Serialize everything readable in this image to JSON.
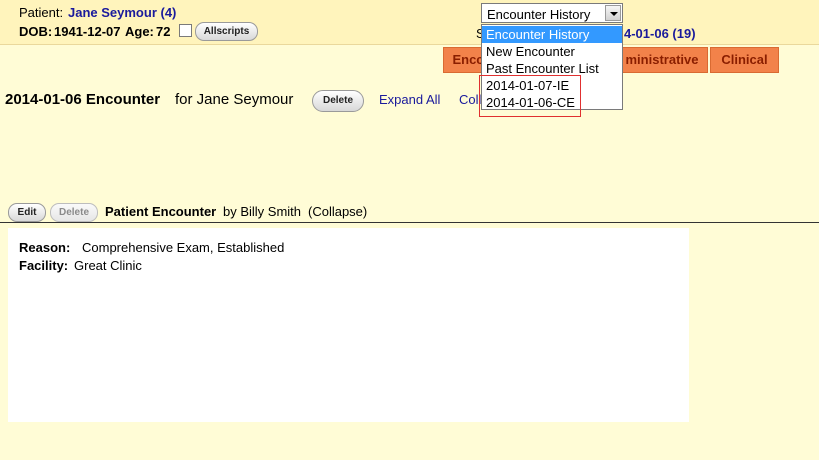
{
  "header": {
    "patient_label": "Patient:",
    "patient_name": "Jane Seymour (4)",
    "dob_label": "DOB:",
    "dob_value": "1941-12-07",
    "age_label": "Age:",
    "age_value": "72",
    "allscripts_label": "Allscripts",
    "encounter_select": {
      "selected": "Encounter History",
      "options": [
        "Encounter History",
        "New Encounter",
        "Past Encounter List",
        "2014-01-07-IE",
        "2014-01-06-CE"
      ]
    },
    "selected_encounter_prefix": "S",
    "selected_encounter_value": "4-01-06 (19)"
  },
  "tabs": {
    "encounter_partial": "Encc",
    "administrative_partial": "ministrative",
    "clinical": "Clinical"
  },
  "encounter": {
    "title": "2014-01-06 Encounter",
    "for_text": "for Jane Seymour",
    "delete_label": "Delete",
    "expand_all": "Expand All",
    "collapse_partial": "Coll"
  },
  "form_header": {
    "edit_label": "Edit",
    "delete_label": "Delete",
    "form_name": "Patient Encounter",
    "by_text": "by Billy Smith",
    "collapse_text": "(Collapse)"
  },
  "details": {
    "reason_label": "Reason:",
    "reason_value": "Comprehensive Exam, Established",
    "facility_label": "Facility:",
    "facility_value": "Great Clinic"
  }
}
